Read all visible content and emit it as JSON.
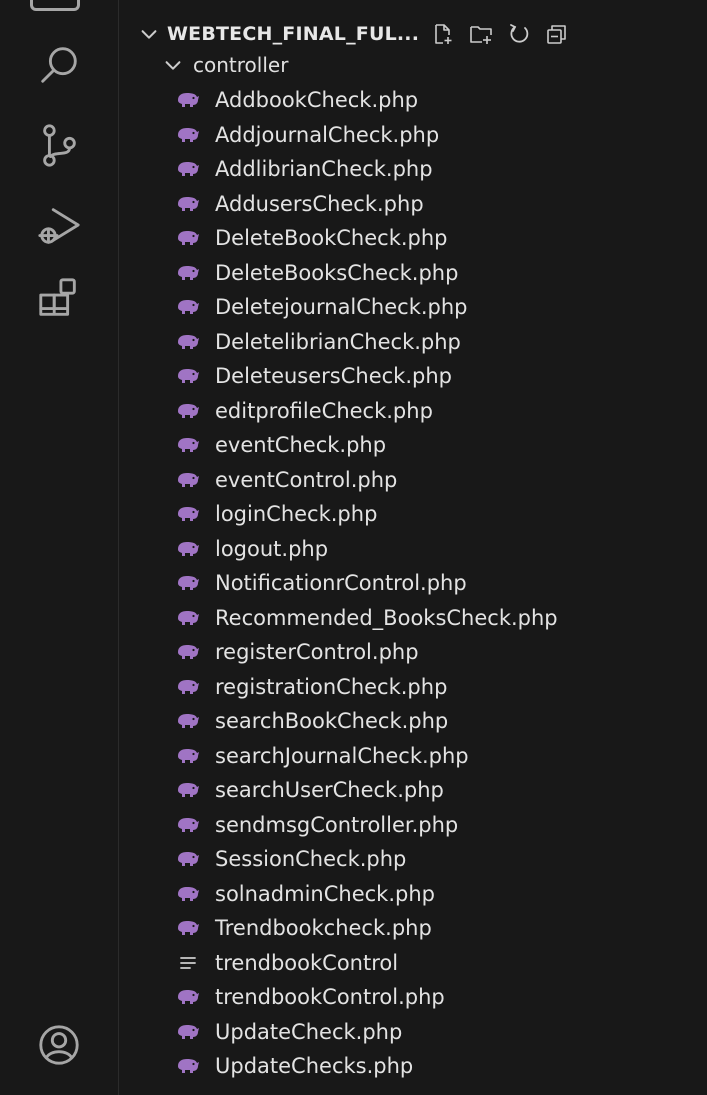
{
  "colors": {
    "php_icon": "#a074c4",
    "text": "#e3e3e3",
    "icon": "#a6a6a6",
    "background": "#181818"
  },
  "activity_bar": [
    {
      "name": "search-icon"
    },
    {
      "name": "source-control-icon"
    },
    {
      "name": "run-debug-icon"
    },
    {
      "name": "extensions-icon"
    },
    {
      "name": "account-icon"
    }
  ],
  "explorer": {
    "section_title": "WEBTECH_FINAL_FUL...",
    "actions": [
      "new-file-icon",
      "new-folder-icon",
      "refresh-icon",
      "collapse-all-icon"
    ],
    "folder": {
      "label": "controller"
    },
    "files": [
      {
        "label": "AddbookCheck.php",
        "type": "php"
      },
      {
        "label": "AddjournalCheck.php",
        "type": "php"
      },
      {
        "label": "AddlibrianCheck.php",
        "type": "php"
      },
      {
        "label": "AddusersCheck.php",
        "type": "php"
      },
      {
        "label": "DeleteBookCheck.php",
        "type": "php"
      },
      {
        "label": "DeleteBooksCheck.php",
        "type": "php"
      },
      {
        "label": "DeletejournalCheck.php",
        "type": "php"
      },
      {
        "label": "DeletelibrianCheck.php",
        "type": "php"
      },
      {
        "label": "DeleteusersCheck.php",
        "type": "php"
      },
      {
        "label": "editprofileCheck.php",
        "type": "php"
      },
      {
        "label": "eventCheck.php",
        "type": "php"
      },
      {
        "label": "eventControl.php",
        "type": "php"
      },
      {
        "label": "loginCheck.php",
        "type": "php"
      },
      {
        "label": "logout.php",
        "type": "php"
      },
      {
        "label": "NotificationrControl.php",
        "type": "php"
      },
      {
        "label": "Recommended_BooksCheck.php",
        "type": "php"
      },
      {
        "label": "registerControl.php",
        "type": "php"
      },
      {
        "label": "registrationCheck.php",
        "type": "php"
      },
      {
        "label": "searchBookCheck.php",
        "type": "php"
      },
      {
        "label": "searchJournalCheck.php",
        "type": "php"
      },
      {
        "label": "searchUserCheck.php",
        "type": "php"
      },
      {
        "label": "sendmsgController.php",
        "type": "php"
      },
      {
        "label": "SessionCheck.php",
        "type": "php"
      },
      {
        "label": "solnadminCheck.php",
        "type": "php"
      },
      {
        "label": "Trendbookcheck.php",
        "type": "php"
      },
      {
        "label": "trendbookControl",
        "type": "text"
      },
      {
        "label": "trendbookControl.php",
        "type": "php"
      },
      {
        "label": "UpdateCheck.php",
        "type": "php"
      },
      {
        "label": "UpdateChecks.php",
        "type": "php"
      }
    ]
  }
}
